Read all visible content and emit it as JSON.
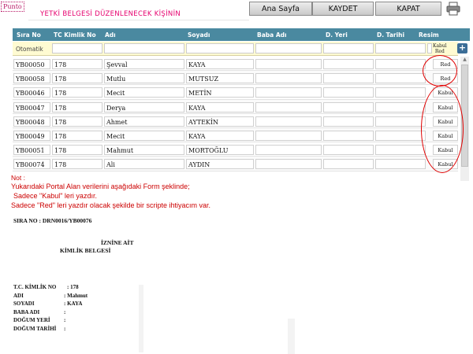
{
  "punto_label": "Punto",
  "form_title": "YETKİ BELGESİ DÜZENLENECEK KİŞİNİN",
  "toolbar": {
    "home_label": "Ana Sayfa",
    "save_label": "KAYDET",
    "close_label": "KAPAT",
    "print_icon": "printer-icon"
  },
  "columns": [
    "Sıra No",
    "TC Kimlik No",
    "Adı",
    "Soyadı",
    "Baba Adı",
    "D. Yeri",
    "D. Tarihi",
    "Resim"
  ],
  "new_row": {
    "label": "Otomatik",
    "status_header_1": "Kabul",
    "status_header_2": "Red",
    "add_icon": "plus-icon"
  },
  "rows": [
    {
      "sira": "YB00050",
      "tc": "178",
      "ad": "Şevval",
      "soyad": "KAYA",
      "status": "Red"
    },
    {
      "sira": "YB00058",
      "tc": "178",
      "ad": "Mutlu",
      "soyad": "MUTSUZ",
      "status": "Red"
    },
    {
      "sira": "YB00046",
      "tc": "178",
      "ad": "Mecit",
      "soyad": "METİN",
      "status": "Kabul"
    },
    {
      "sira": "YB00047",
      "tc": "178",
      "ad": "Derya",
      "soyad": "KAYA",
      "status": "Kabul"
    },
    {
      "sira": "YB00048",
      "tc": "178",
      "ad": "Ahmet",
      "soyad": "AYTEKİN",
      "status": "Kabul"
    },
    {
      "sira": "YB00049",
      "tc": "178",
      "ad": "Mecit",
      "soyad": "KAYA",
      "status": "Kabul"
    },
    {
      "sira": "YB00051",
      "tc": "178",
      "ad": "Mahmut",
      "soyad": "MORTOĞLU",
      "status": "Kabul"
    },
    {
      "sira": "YB00074",
      "tc": "178",
      "ad": "Ali",
      "soyad": "AYDIN",
      "status": "Kabul"
    }
  ],
  "note": {
    "title": "Not :",
    "line1": "Yukarıdaki Portal Alan verilerini aşağıdaki Form şeklinde;",
    "line2": "Sadece \"Kabul\" leri yazdır.",
    "line3": "Sadece \"Red\" leri yazdır olacak şekilde bir scripte ihtiyacım var."
  },
  "document": {
    "sira_label": "SIRA NO :",
    "sira_value": "DRN0016/YB00076",
    "title_line1": "İZNİNE AİT",
    "title_line2": "KİMLİK BELGESİ",
    "fields": [
      {
        "label": "T.C. KİMLİK NO",
        "value": ": 178"
      },
      {
        "label": "ADI",
        "value": ": Mahmut"
      },
      {
        "label": "SOYADI",
        "value": ": KAYA"
      },
      {
        "label": "BABA ADI",
        "value": ":"
      },
      {
        "label": "DOĞUM YERİ",
        "value": ":"
      },
      {
        "label": "DOĞUM TARİHİ",
        "value": ":"
      }
    ]
  },
  "colors": {
    "header_bg": "#4a89a0",
    "title_pink": "#e6006e",
    "note_red": "#cc0000",
    "new_row_bg": "#fffbd2"
  }
}
